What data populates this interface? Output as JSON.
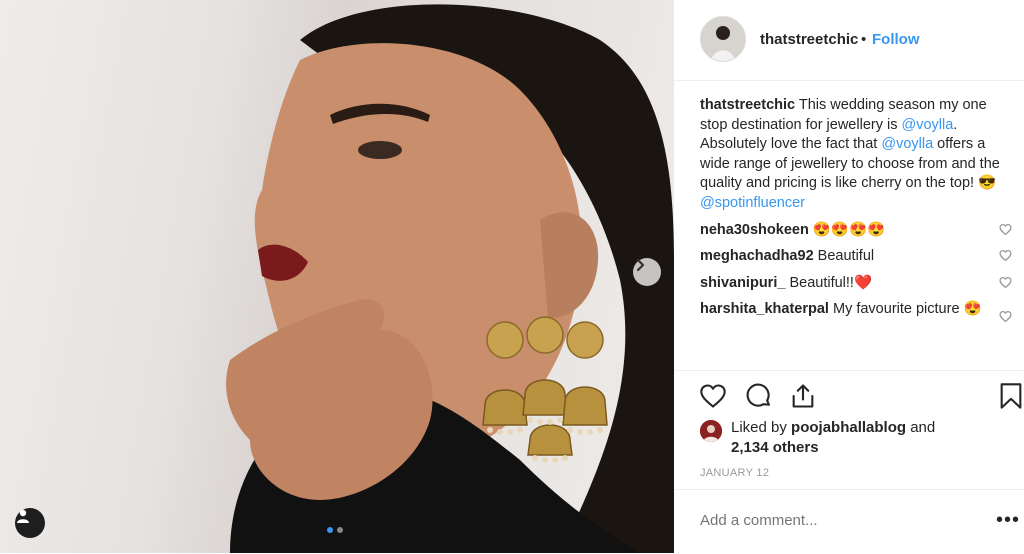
{
  "post": {
    "username": "thatstreetchic",
    "separator": "•",
    "follow_label": "Follow",
    "caption_parts": {
      "text1": " This wedding season my one stop destination for jewellery is ",
      "mention1": "@voylla",
      "text2": ". Absolutely love the fact that ",
      "mention2": "@voylla",
      "text3": " offers a wide range of jewellery to choose from and the quality and pricing is like cherry on the top! 😎",
      "hashtag": "@spotinfluencer"
    },
    "comments": [
      {
        "user": "neha30shokeen",
        "text": "😍😍😍😍"
      },
      {
        "user": "meghachadha92",
        "text": "Beautiful"
      },
      {
        "user": "shivanipuri_",
        "text": "Beautiful!!❤️"
      },
      {
        "user": "harshita_khaterpal",
        "text": "My favourite picture 😍"
      }
    ],
    "likes": {
      "prefix": "Liked by ",
      "liker": "poojabhallablog",
      "middle": " and ",
      "others": "2,134 others"
    },
    "date": "JANUARY 12",
    "add_comment_placeholder": "Add a comment...",
    "more_label": "•••"
  },
  "icons": {
    "like": "heart-icon",
    "comment": "comment-icon",
    "share": "share-icon",
    "save": "bookmark-icon",
    "next": "chevron-right-icon",
    "user_tag": "user-icon"
  },
  "colors": {
    "accent": "#3897f0",
    "text": "#262626",
    "muted": "#999999"
  }
}
